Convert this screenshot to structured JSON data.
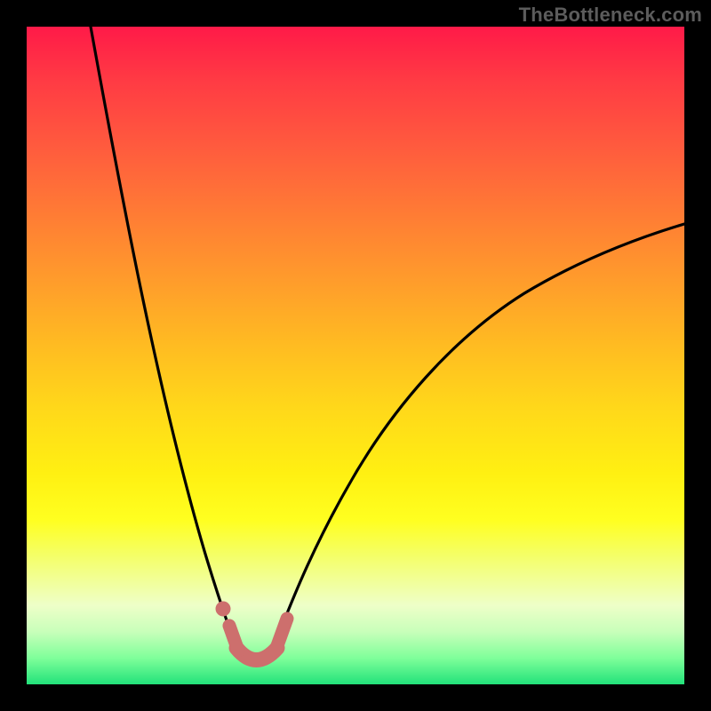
{
  "watermark": {
    "text": "TheBottleneck.com"
  },
  "colors": {
    "frame": "#000000",
    "curve": "#000000",
    "marker": "#cd6f6d"
  },
  "chart_data": {
    "type": "line",
    "title": "",
    "xlabel": "",
    "ylabel": "",
    "xlim": [
      0,
      100
    ],
    "ylim": [
      0,
      100
    ],
    "grid": false,
    "legend": false,
    "series": [
      {
        "name": "left-branch",
        "x": [
          10,
          12,
          14,
          16,
          18,
          20,
          22,
          24,
          26,
          28,
          29,
          30,
          31,
          32,
          33
        ],
        "y": [
          100,
          91,
          82,
          73,
          64,
          55,
          46,
          37,
          28,
          19,
          14,
          10,
          7,
          5,
          3
        ]
      },
      {
        "name": "right-branch",
        "x": [
          38,
          39,
          40,
          42,
          44,
          47,
          50,
          54,
          58,
          63,
          68,
          74,
          80,
          87,
          94,
          100
        ],
        "y": [
          3,
          5,
          7,
          11,
          16,
          22,
          28,
          34,
          40,
          46,
          51,
          56,
          60,
          64,
          67,
          70
        ]
      }
    ],
    "markers": {
      "name": "bottom-points",
      "x": [
        30,
        32.2,
        33.5,
        34.8,
        36.1,
        37.4,
        38.5
      ],
      "y": [
        11,
        4,
        2.5,
        2,
        2.5,
        4,
        7
      ]
    },
    "note": "Values are estimated from pixel positions; axes are unlabeled in the source image."
  }
}
